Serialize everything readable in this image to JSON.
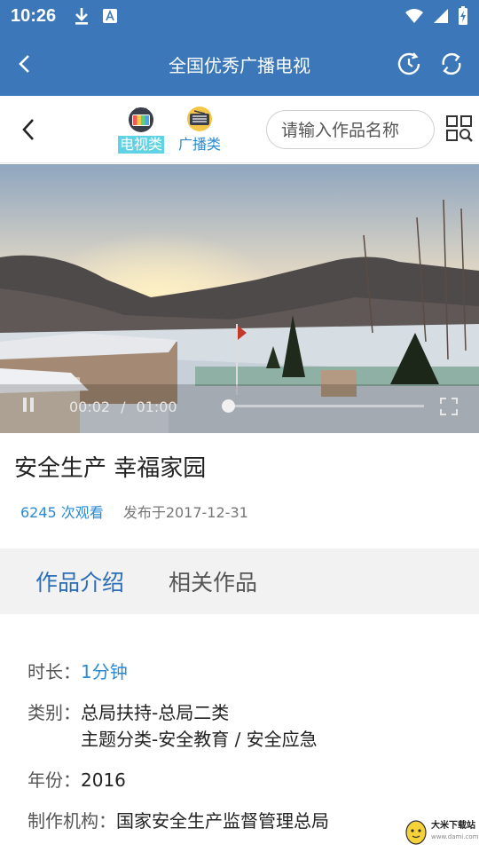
{
  "status_bar": {
    "time": "10:26",
    "icons_left": [
      "download-icon",
      "keyboard-a-icon"
    ],
    "icons_right": [
      "wifi-icon",
      "signal-icon",
      "battery-charging-icon"
    ],
    "color": "#3c78b9"
  },
  "app_bar": {
    "title": "全国优秀广播电视",
    "icons": [
      "back-arrow-icon",
      "history-icon",
      "refresh-icon"
    ]
  },
  "nav": {
    "categories": [
      {
        "label": "电视类",
        "icon": "tv-icon",
        "active": true
      },
      {
        "label": "广播类",
        "icon": "radio-icon",
        "active": false
      }
    ],
    "search_placeholder": "请输入作品名称",
    "icons": [
      "chevron-left-icon",
      "grid-search-icon"
    ]
  },
  "player": {
    "current_time": "00:02",
    "separator": "/",
    "duration": "01:00",
    "progress_fraction": 0.033,
    "icons": [
      "pause-icon",
      "fullscreen-icon"
    ]
  },
  "work": {
    "title": "安全生产 幸福家园",
    "views": "6245 次观看",
    "published": "发布于2017-12-31"
  },
  "tabs": [
    {
      "label": "作品介绍",
      "active": true
    },
    {
      "label": "相关作品",
      "active": false
    }
  ],
  "details": {
    "duration_key": "时长：",
    "duration_val": "1分钟",
    "category_key": "类别：",
    "category_line1": "总局扶持-总局二类",
    "category_line2": "主题分类-安全教育 / 安全应急",
    "year_key": "年份：",
    "year_val": "2016",
    "producer_key": "制作机构：",
    "producer_val": "国家安全生产监督管理总局"
  },
  "watermark": {
    "main": "大米下载站",
    "sub": "www.dami.com"
  },
  "colors": {
    "primary": "#3c78b9",
    "accent_blue": "#2a8ad4",
    "active_tab_bg": "#5fd2e6"
  }
}
